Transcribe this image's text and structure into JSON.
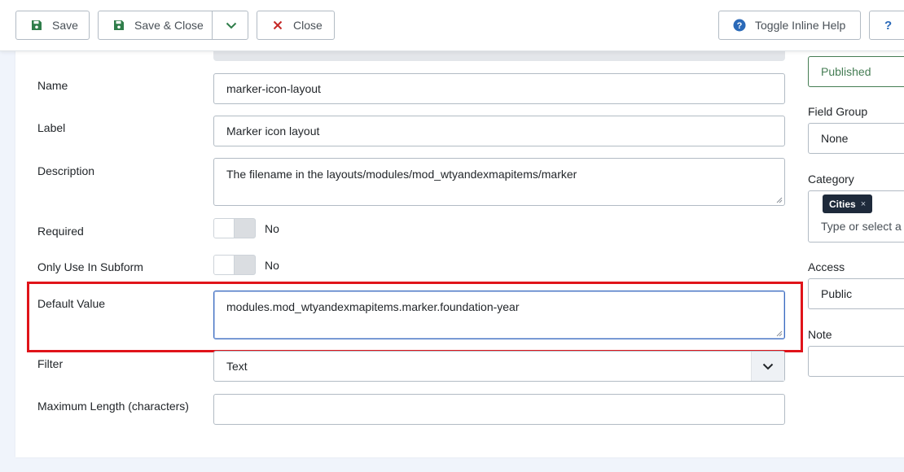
{
  "toolbar": {
    "save": "Save",
    "save_close": "Save & Close",
    "close": "Close",
    "toggle_help": "Toggle Inline Help",
    "help": "?"
  },
  "form": {
    "name_label": "Name",
    "name_value": "marker-icon-layout",
    "label_label": "Label",
    "label_value": "Marker icon layout",
    "description_label": "Description",
    "description_value": "The filename in the layouts/modules/mod_wtyandexmapitems/marker",
    "required_label": "Required",
    "required_value": "No",
    "subform_label": "Only Use In Subform",
    "subform_value": "No",
    "default_label": "Default Value",
    "default_value": "modules.mod_wtyandexmapitems.marker.foundation-year",
    "filter_label": "Filter",
    "filter_value": "Text",
    "maxlen_label": "Maximum Length (characters)",
    "maxlen_value": ""
  },
  "sidebar": {
    "status_value": "Published",
    "field_group_label": "Field Group",
    "field_group_value": "None",
    "category_label": "Category",
    "category_tag": "Cities",
    "category_tag_remove": "×",
    "category_placeholder": "Type or select a",
    "access_label": "Access",
    "access_value": "Public",
    "note_label": "Note",
    "note_value": ""
  },
  "colors": {
    "highlight": "#e0141a",
    "published": "#457d54",
    "tag_bg": "#1e2a3b"
  }
}
